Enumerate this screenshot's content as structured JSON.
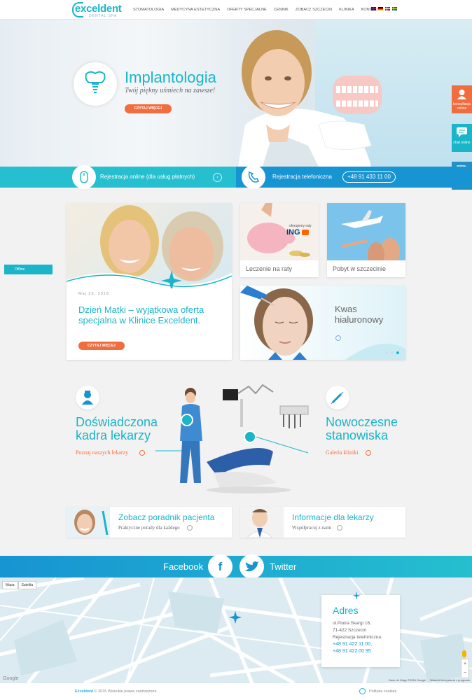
{
  "logo": {
    "name": "exceldent",
    "tagline": "DENTAL SPA"
  },
  "nav": [
    "STOMATOLOGIA",
    "MEDYCYNA ESTETYCZNA",
    "OFERTY SPECJALNE",
    "CENNIK",
    "ZOBACZ SZCZECIN",
    "KLINIKA",
    "KONTAKT"
  ],
  "hero": {
    "title": "Implantologia",
    "subtitle": "Twój piękny uśmiech na zawsze!",
    "button": "CZYTAJ WIĘCEJ"
  },
  "side_tabs": [
    "konsultacja online",
    "chat online",
    "blog"
  ],
  "registration": {
    "online": "Rejestracja online (dla usług płatnych)",
    "phone_label": "Rejestracja telefoniczna",
    "phone": "+48 91 433 11 00"
  },
  "offline": "Offline",
  "news": {
    "date": "Maj 23, 2016",
    "title": "Dzień Matki – wyjątkowa oferta specjalna w Klinice Exceldent.",
    "button": "CZYTAJ WIĘCEJ"
  },
  "promos": {
    "installments": "Leczenie na raty",
    "installments_tag": "oferujemy raty",
    "bank": "ING",
    "stay": "Pobyt w szczecinie",
    "acid": "Kwas hialuronowy"
  },
  "features": {
    "staff_title": "Doświadczona kadra lekarzy",
    "staff_link": "Poznaj naszych lekarzy",
    "stations_title": "Nowoczesne stanowiska",
    "stations_link": "Galeria kliniki"
  },
  "tiles": [
    {
      "title": "Zobacz poradnik pacjenta",
      "sub": "Praktyczne porady dla każdego"
    },
    {
      "title": "Informacje dla lekarzy",
      "sub": "Współpracuj z nami"
    }
  ],
  "social": {
    "facebook": "Facebook",
    "twitter": "Twitter"
  },
  "map": {
    "controls": [
      "Mapa",
      "Satelita"
    ],
    "address_title": "Adres",
    "street": "ul.Piotra Skargi 16,",
    "city": "71-422 Szczecin",
    "phone_label": "Rejestracja telefoniczna:",
    "phone1": "+48 91 422 11 00,",
    "phone2": "+48 91 422 00 95",
    "copy1": "Dane do Mapy ©2016 Google",
    "copy2": "Warunki korzystania z programu",
    "google": "Google"
  },
  "footer": {
    "brand": "Exceldent",
    "copy": "© 2016 Wszelkie prawa zastrzeżone",
    "cookies": "Polityka cookies"
  },
  "colors": {
    "teal": "#1ab5c8",
    "blue": "#1794d2",
    "orange": "#f26d3d"
  }
}
